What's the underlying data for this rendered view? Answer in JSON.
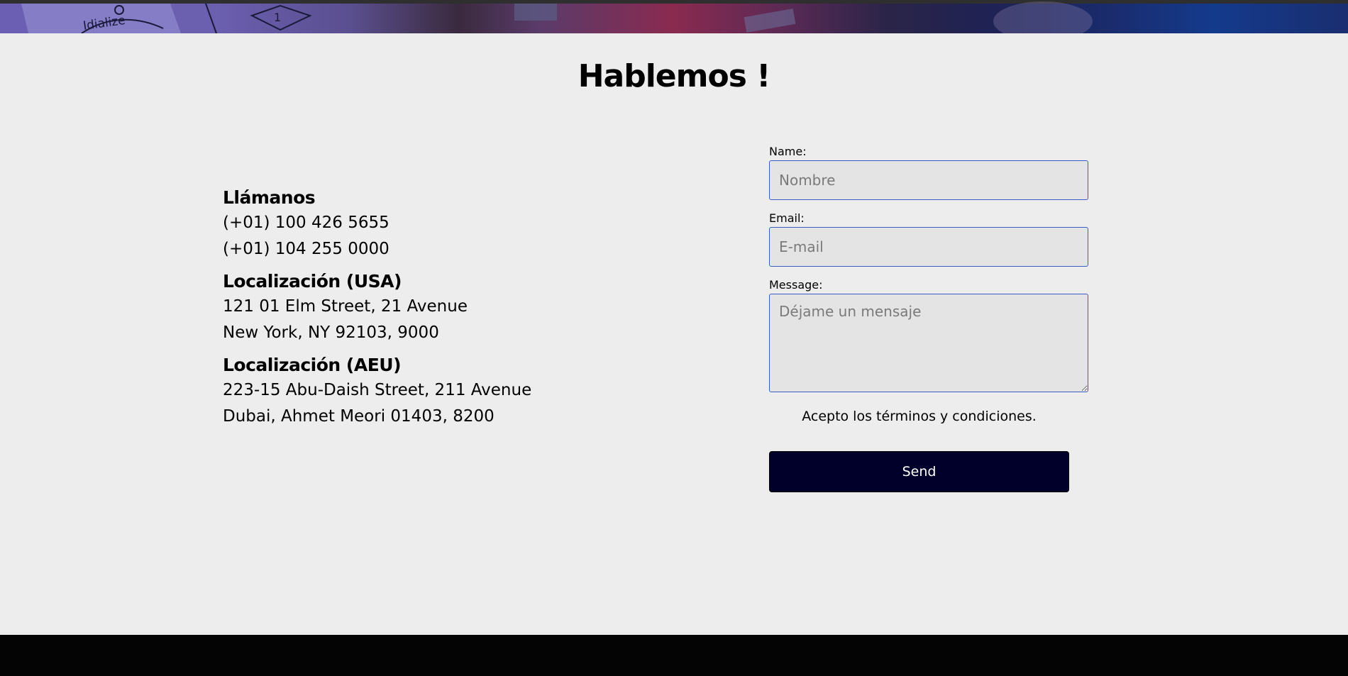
{
  "hero": {
    "decor_text_left": "Idialize",
    "decor_text_number": "1"
  },
  "page": {
    "title": "Hablemos !"
  },
  "contact_info": [
    {
      "heading": "Llámanos",
      "lines": [
        "(+01) 100 426 5655",
        "(+01) 104 255 0000"
      ]
    },
    {
      "heading": "Localización (USA)",
      "lines": [
        "121 01 Elm Street, 21 Avenue",
        "New York, NY 92103, 9000"
      ]
    },
    {
      "heading": "Localización (AEU)",
      "lines": [
        "223-15 Abu-Daish Street, 211 Avenue",
        "Dubai, Ahmet Meori 01403, 8200"
      ]
    }
  ],
  "form": {
    "name_label": "Name:",
    "name_placeholder": "Nombre",
    "email_label": "Email:",
    "email_placeholder": "E-mail",
    "message_label": "Message:",
    "message_placeholder": "Déjame un mensaje",
    "terms_text": "Acepto los términos y condiciones.",
    "send_label": "Send"
  },
  "colors": {
    "page_background": "#ededed",
    "input_border": "#3b5bc4",
    "input_background": "#e4e4e4",
    "button_background": "#01002a",
    "footer_background": "#040404"
  }
}
